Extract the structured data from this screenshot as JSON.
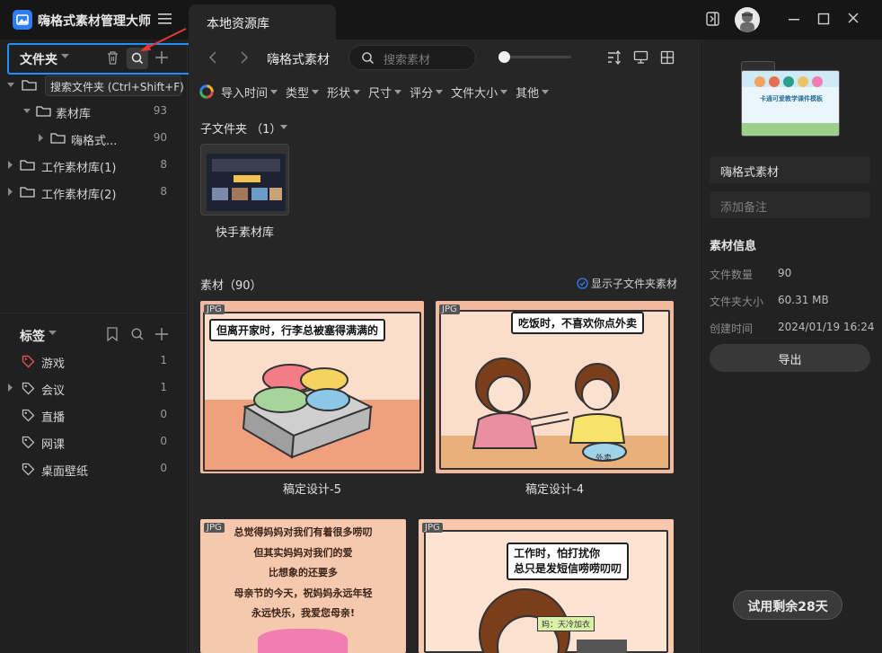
{
  "app": {
    "title": "嗨格式素材管理大师",
    "tab": "本地资源库"
  },
  "folders": {
    "title": "文件夹",
    "tooltip": "搜索文件夹 (Ctrl+Shift+F)",
    "items": [
      {
        "label": "素材库",
        "count": "93"
      },
      {
        "label": "嗨格式...",
        "count": "90"
      },
      {
        "label": "工作素材库(1)",
        "count": "8"
      },
      {
        "label": "工作素材库(2)",
        "count": "8"
      }
    ]
  },
  "tags": {
    "title": "标签",
    "items": [
      {
        "label": "游戏",
        "count": "1"
      },
      {
        "label": "会议",
        "count": "1"
      },
      {
        "label": "直播",
        "count": "0"
      },
      {
        "label": "网课",
        "count": "0"
      },
      {
        "label": "桌面壁纸",
        "count": "0"
      }
    ]
  },
  "toolbar": {
    "breadcrumb": "嗨格式素材",
    "search_placeholder": "搜索素材"
  },
  "filters": [
    "导入时间",
    "类型",
    "形状",
    "尺寸",
    "评分",
    "文件大小",
    "其他"
  ],
  "subfolders": {
    "header": "子文件夹 （1）",
    "items": [
      {
        "name": "快手素材库"
      }
    ]
  },
  "assets": {
    "header": "素材（90）",
    "show_sub_label": "显示子文件夹素材",
    "items": [
      {
        "badge": "JPG",
        "name": "稿定设计-5",
        "bubble": "但离开家时，行李总被塞得满满的"
      },
      {
        "badge": "JPG",
        "name": "稿定设计-4",
        "bubble": "吃饭时，不喜欢你点外卖",
        "tag": "外卖"
      },
      {
        "badge": "JPG",
        "lines": [
          "总觉得妈妈对我们有着很多唠叨",
          "但其实妈妈对我们的爱",
          "比想象的还要多",
          "母亲节的今天，祝妈妈永远年轻",
          "永远快乐，我爱您母亲!"
        ]
      },
      {
        "badge": "JPG",
        "bubble_lines": [
          "工作时，怕打扰你",
          "总只是发短信唠唠叨叨"
        ],
        "tag": "妈：天冷加衣"
      }
    ]
  },
  "details": {
    "name": "嗨格式素材",
    "note_placeholder": "添加备注",
    "info_title": "素材信息",
    "rows": [
      {
        "key": "文件数量",
        "value": "90"
      },
      {
        "key": "文件夹大小",
        "value": "60.31 MB"
      },
      {
        "key": "创建时间",
        "value": "2024/01/19 16:24"
      }
    ],
    "export_label": "导出",
    "preview_caption": "卡通可爱教学课件模板"
  },
  "trial": {
    "label": "试用剩余28天"
  },
  "colors": {
    "accent": "#2f7cf6",
    "highlight_border": "#1e90ff",
    "annotation_arrow": "#e53935"
  }
}
